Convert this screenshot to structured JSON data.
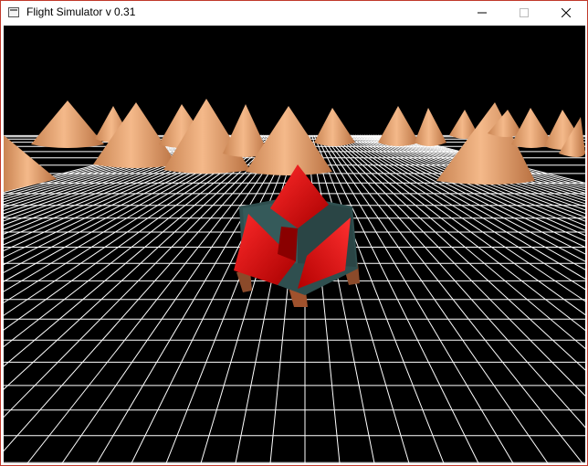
{
  "window": {
    "title": "Flight Simulator v 0.31",
    "icon": "app-window-icon",
    "controls": [
      "minimize-icon",
      "maximize-icon",
      "close-icon"
    ]
  },
  "scene": {
    "sky_color": "#000000",
    "grid_color": "#ffffff",
    "ground_color": "#000000",
    "cone_color": "#e8a36a",
    "player_color": "#e60000",
    "player_body_color": "#2f4f4f",
    "player_legs_color": "#a0522d"
  }
}
